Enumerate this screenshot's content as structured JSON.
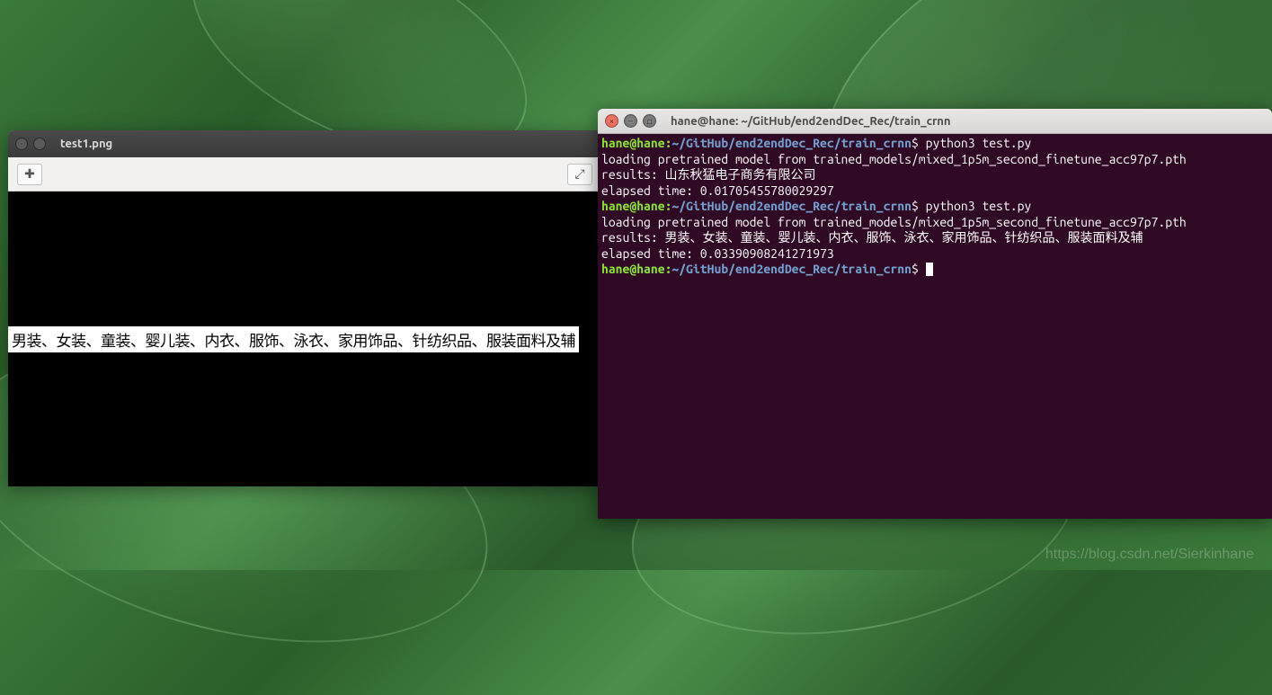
{
  "image_viewer": {
    "title": "test1.png",
    "content_text": "男装、女装、童装、婴儿装、内衣、服饰、泳衣、家用饰品、针纺织品、服装面料及辅"
  },
  "terminal": {
    "title": "hane@hane: ~/GitHub/end2endDec_Rec/train_crnn",
    "prompt_user": "hane@hane",
    "prompt_path": "~/GitHub/end2endDec_Rec/train_crnn",
    "sessions": [
      {
        "command": "python3 test.py",
        "output": "loading pretrained model from trained_models/mixed_1p5m_second_finetune_acc97p7.pth\nresults: 山东秋猛电子商务有限公司\nelapsed time: 0.01705455780029297"
      },
      {
        "command": "python3 test.py",
        "output": "loading pretrained model from trained_models/mixed_1p5m_second_finetune_acc97p7.pth\nresults: 男装、女装、童装、婴儿装、内衣、服饰、泳衣、家用饰品、针纺织品、服装面料及辅\nelapsed time: 0.03390908241271973"
      }
    ]
  },
  "watermark": "https://blog.csdn.net/Sierkinhane"
}
